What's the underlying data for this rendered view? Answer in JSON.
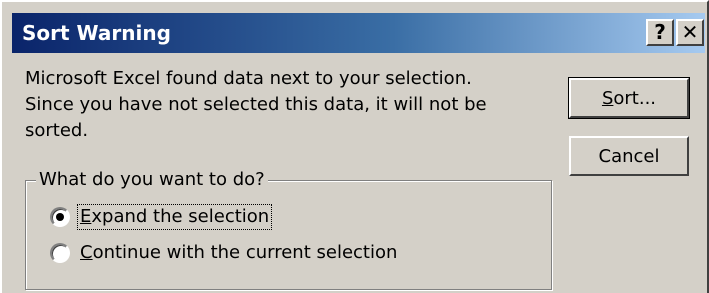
{
  "dialog": {
    "title": "Sort Warning",
    "help_label": "?",
    "close_label": "✕",
    "message_lines": [
      "Microsoft Excel found data next to your selection.",
      "Since you have not selected this data, it will not be",
      "sorted."
    ],
    "group": {
      "legend": "What do you want to do?",
      "options": [
        {
          "mnemonic": "E",
          "rest": "xpand the selection",
          "selected": true
        },
        {
          "mnemonic": "C",
          "rest": "ontinue with the current selection",
          "selected": false
        }
      ]
    },
    "buttons": {
      "sort": {
        "mnemonic": "S",
        "rest": "ort..."
      },
      "cancel": "Cancel"
    }
  }
}
